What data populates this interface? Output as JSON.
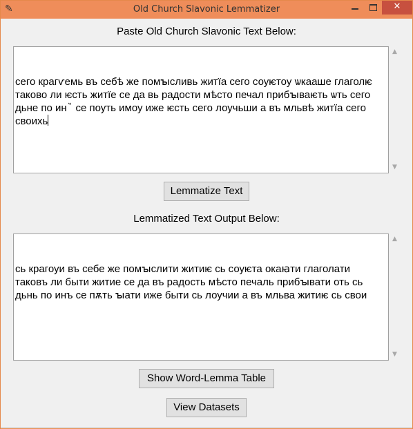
{
  "window": {
    "title": "Old Church Slavonic Lemmatizer",
    "app_icon": "feather-icon",
    "minimize_icon": "minimize-icon",
    "maximize_icon": "maximize-icon",
    "close_label": "✕"
  },
  "input": {
    "label": "Paste Old Church Slavonic Text Below:",
    "text": "сего крагѵемь въ себѣ же помꙑсливь житїа сего соуѥтоу ѡкааше глаголѥ таково ли ѥсть житїе се да вь радости мѣсто печал прибꙑваѥть ѡть сего дьне по инꙿ се поуть имоу иже ѥсть сего лоучьши а въ мльвѣ житїа сего своихь"
  },
  "buttons": {
    "lemmatize": "Lemmatize Text",
    "show_table": "Show Word-Lemma Table",
    "view_datasets": "View Datasets"
  },
  "output": {
    "label": "Lemmatized Text Output Below:",
    "text": "сь крагоуи въ себе же помꙑслити житиѥ сь соуѥта окаꙗти глаголати таковъ ли быти житие се да въ радость мѣсто печаль прибꙑвати оть сь дьнь по инъ се пѫть ꙑати иже быти сь лоучии а въ мльва житиѥ сь свои"
  },
  "colors": {
    "titlebar": "#ef8d5a",
    "close_button": "#c7503f",
    "window_bg": "#f0f0f0"
  }
}
